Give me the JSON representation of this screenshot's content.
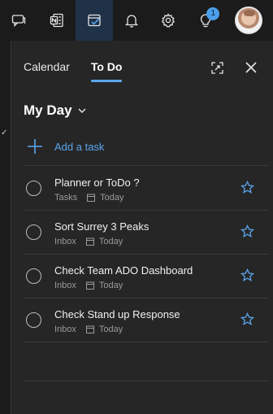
{
  "toolbar": {
    "items": [
      {
        "name": "feedback-icon"
      },
      {
        "name": "onenote-icon"
      },
      {
        "name": "todo-icon",
        "active": true
      },
      {
        "name": "bell-icon"
      },
      {
        "name": "gear-icon"
      },
      {
        "name": "lightbulb-icon",
        "badge": "1"
      }
    ],
    "avatar": "profile-avatar"
  },
  "tabs": {
    "calendar": "Calendar",
    "todo": "To Do"
  },
  "list": {
    "title": "My Day",
    "add_task": "Add a task"
  },
  "tasks": [
    {
      "title": "Planner or ToDo ?",
      "list": "Tasks",
      "due": "Today"
    },
    {
      "title": "Sort Surrey 3 Peaks",
      "list": "Inbox",
      "due": "Today"
    },
    {
      "title": "Check Team ADO Dashboard",
      "list": "Inbox",
      "due": "Today"
    },
    {
      "title": "Check Stand up Response",
      "list": "Inbox",
      "due": "Today"
    }
  ],
  "colors": {
    "accent": "#5aa6ef",
    "panel": "#262626",
    "toolbar": "#1b1b1b",
    "active_tab_bg": "#1f3248"
  }
}
